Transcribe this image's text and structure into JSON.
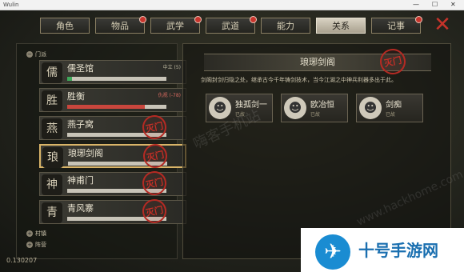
{
  "window": {
    "title": "Wulin",
    "min": "—",
    "max": "☐",
    "close": "✕"
  },
  "tabs": [
    {
      "label": "角色",
      "badge": false
    },
    {
      "label": "物品",
      "badge": true
    },
    {
      "label": "武学",
      "badge": true
    },
    {
      "label": "武道",
      "badge": true
    },
    {
      "label": "能力",
      "badge": false
    },
    {
      "label": "关系",
      "badge": false,
      "active": true
    },
    {
      "label": "记事",
      "badge": true
    }
  ],
  "close_glyph": "✕",
  "left_panel": {
    "group_open": {
      "toggle": "−",
      "label": "门派"
    },
    "sects": [
      {
        "name": "儒圣馆",
        "emblem": "儒",
        "status": "中立 (5)",
        "status_color": "#b9b39c",
        "bar_fill": 0.05,
        "bar_color": "#3fa85a",
        "stamp": ""
      },
      {
        "name": "胜衡",
        "emblem": "胜",
        "status": "仇视 (-78)",
        "status_color": "#d86a5f",
        "bar_fill": 0.78,
        "bar_color": "#c9463d",
        "stamp": ""
      },
      {
        "name": "燕子窝",
        "emblem": "燕",
        "status": "",
        "status_color": "#b9b39c",
        "bar_fill": 0,
        "bar_color": "#888",
        "stamp": "灭门"
      },
      {
        "name": "琅琊剑阁",
        "emblem": "琅",
        "status": "",
        "status_color": "#b9b39c",
        "bar_fill": 0,
        "bar_color": "#888",
        "stamp": "灭门",
        "selected": true
      },
      {
        "name": "神甫门",
        "emblem": "神",
        "status": "",
        "status_color": "#b9b39c",
        "bar_fill": 0,
        "bar_color": "#888",
        "stamp": "灭门"
      },
      {
        "name": "青风寨",
        "emblem": "青",
        "status": "",
        "status_color": "#b9b39c",
        "bar_fill": 0,
        "bar_color": "#888",
        "stamp": "灭门"
      }
    ],
    "group_village": {
      "toggle": "+",
      "label": "村镇"
    },
    "group_camp": {
      "toggle": "+",
      "label": "阵营"
    }
  },
  "right_panel": {
    "title": "琅琊剑阁",
    "stamp": "灭门",
    "description": "剑阁封剑归隐之处，继承古今千年铸剑技术，当今江湖之中神兵利器多出于此。",
    "characters": [
      {
        "name": "独孤剑一",
        "status": "已故",
        "portrait": "☻"
      },
      {
        "name": "欧冶恒",
        "status": "已故",
        "portrait": "☻"
      },
      {
        "name": "剑痴",
        "status": "已故",
        "portrait": "☻"
      }
    ]
  },
  "version": "0.130207",
  "watermark": {
    "text1": "嗨客手机站",
    "text2": "www.hackhome.com"
  },
  "ad": {
    "logo": "✈",
    "text": "十号手游网"
  }
}
